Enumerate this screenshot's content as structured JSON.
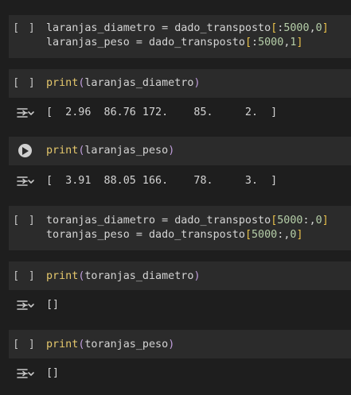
{
  "cells": [
    {
      "run_label": "[ ]",
      "lines": [
        [
          "laranjas_diametro",
          " = ",
          "dado_transposto",
          "[",
          ":",
          "5000",
          ",",
          "0",
          "]"
        ],
        [
          "laranjas_peso",
          " = ",
          "dado_transposto",
          "[",
          ":",
          "5000",
          ",",
          "1",
          "]"
        ]
      ]
    },
    {
      "run_label": "[ ]",
      "lines": [
        [
          "print",
          "(",
          "laranjas_diametro",
          ")"
        ]
      ],
      "output": "[  2.96  86.76 172.    85.     2.  ]"
    },
    {
      "run_label": "",
      "lines": [
        [
          "print",
          "(",
          "laranjas_peso",
          ")"
        ]
      ],
      "output": "[  3.91  88.05 166.    78.     3.  ]"
    },
    {
      "run_label": "[ ]",
      "lines": [
        [
          "toranjas_diametro",
          " = ",
          "dado_transposto",
          "[",
          "5000",
          ":",
          ",",
          "0",
          "]"
        ],
        [
          "toranjas_peso",
          " = ",
          "dado_transposto",
          "[",
          "5000",
          ":",
          ",",
          "0",
          "]"
        ]
      ]
    },
    {
      "run_label": "[ ]",
      "lines": [
        [
          "print",
          "(",
          "toranjas_diametro",
          ")"
        ]
      ],
      "output": "[]"
    },
    {
      "run_label": "[ ]",
      "lines": [
        [
          "print",
          "(",
          "toranjas_peso",
          ")"
        ]
      ],
      "output": "[]"
    }
  ],
  "icons": {
    "output_menu": "output-menu-icon",
    "run": "play-icon"
  },
  "colors": {
    "background": "#1e1e1e",
    "cell_background": "#2b2b2b",
    "function": "#e4c76c",
    "paren": "#c09edc",
    "bracket": "#e8c14a",
    "number": "#b5cea8"
  }
}
